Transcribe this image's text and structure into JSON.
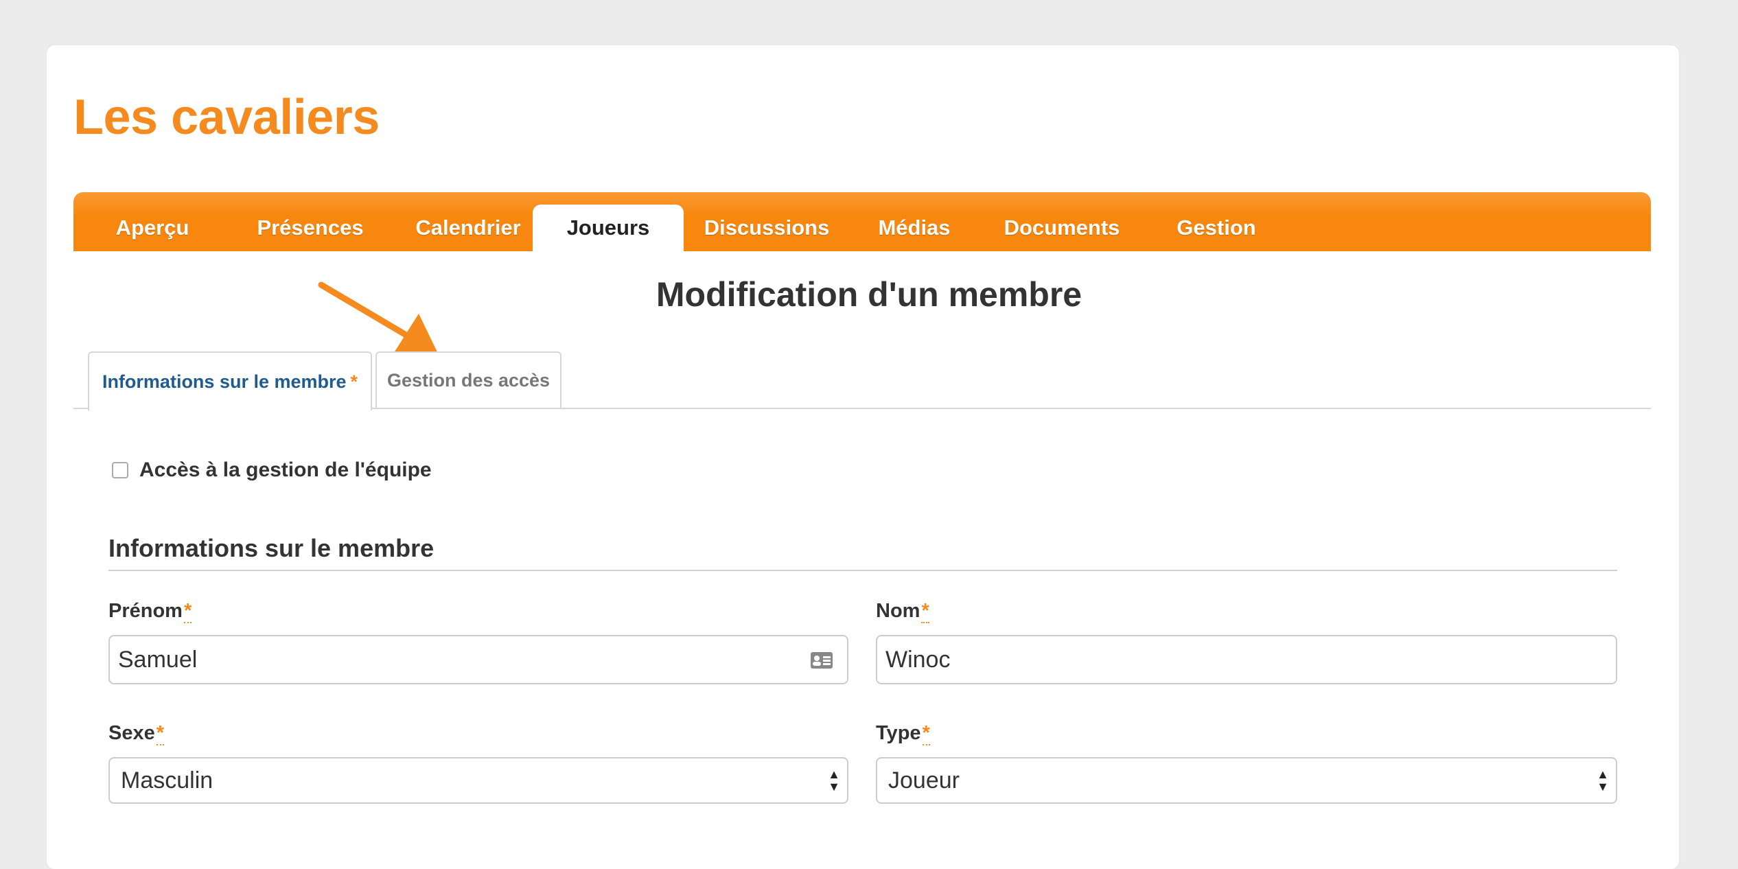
{
  "team": {
    "name": "Les cavaliers"
  },
  "nav": {
    "items": [
      {
        "label": "Aperçu"
      },
      {
        "label": "Présences"
      },
      {
        "label": "Calendrier"
      },
      {
        "label": "Joueurs",
        "active": true
      },
      {
        "label": "Discussions"
      },
      {
        "label": "Médias"
      },
      {
        "label": "Documents"
      },
      {
        "label": "Gestion"
      }
    ]
  },
  "page": {
    "title": "Modification d'un membre"
  },
  "tabs": [
    {
      "label": "Informations sur le membre",
      "required_mark": "*",
      "active": true
    },
    {
      "label": "Gestion des accès",
      "active": false
    }
  ],
  "access": {
    "label": "Accès à la gestion de l'équipe",
    "checked": false
  },
  "section": {
    "title": "Informations sur le membre"
  },
  "fields": {
    "prenom": {
      "label": "Prénom",
      "required_mark": "*",
      "value": "Samuel",
      "icon": "contact-card-icon"
    },
    "nom": {
      "label": "Nom",
      "required_mark": "*",
      "value": "Winoc"
    },
    "sexe": {
      "label": "Sexe",
      "required_mark": "*",
      "value": "Masculin"
    },
    "type": {
      "label": "Type",
      "required_mark": "*",
      "value": "Joueur"
    }
  },
  "colors": {
    "brand_orange": "#f7870e",
    "tab_active_text": "#1f5b8e",
    "arrow": "#f58a1e"
  }
}
